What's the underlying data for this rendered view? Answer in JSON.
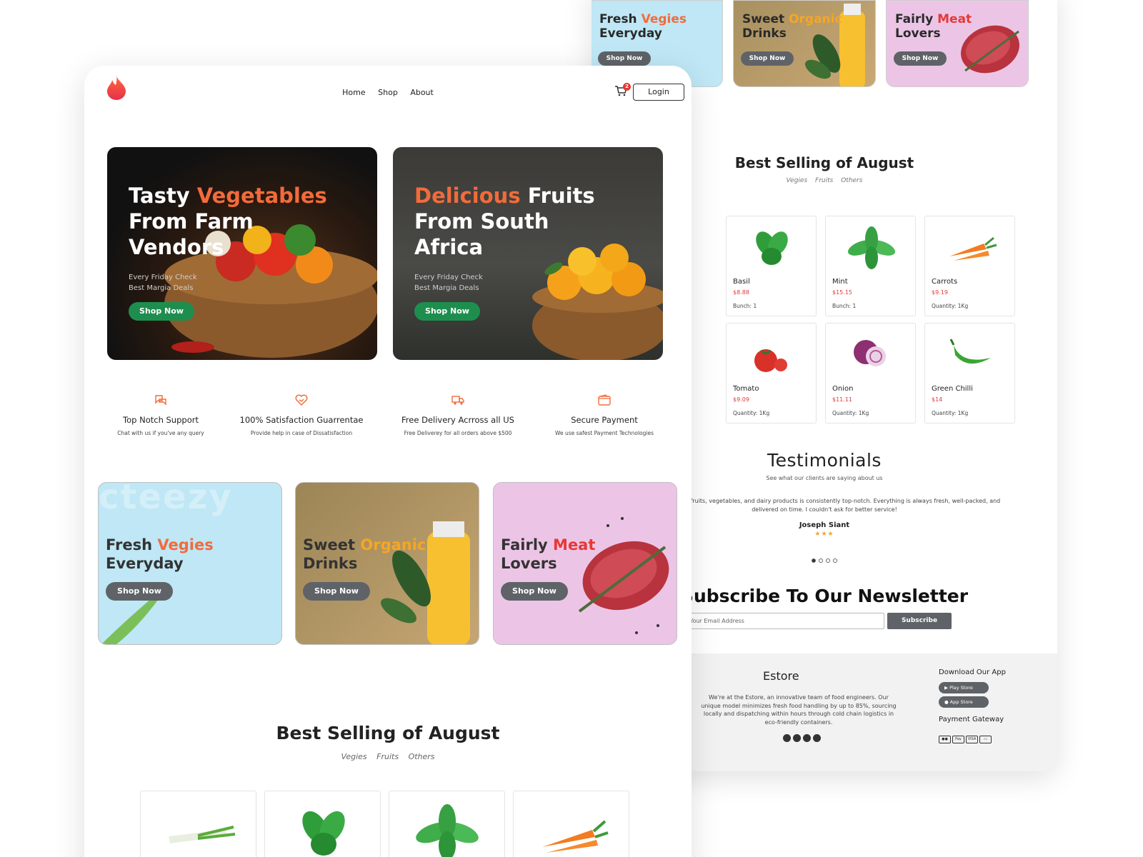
{
  "colors": {
    "accent_orange": "#f26b3a",
    "accent_red": "#e53935",
    "accent_yellow": "#f5a623",
    "green_button": "#1e8e4e",
    "grey_button": "#5f6368"
  },
  "nav": {
    "items": [
      "Home",
      "Shop",
      "About"
    ],
    "cart_count": "2",
    "login": "Login"
  },
  "hero": [
    {
      "line1_a": "Tasty ",
      "line1_b": "Vegetables",
      "line2": "From Farm",
      "line3": "Vendors",
      "sub1": "Every Friday Check",
      "sub2": "Best Margia Deals",
      "button": "Shop Now"
    },
    {
      "line1_a": "Delicious",
      "line1_b": " Fruits",
      "line2": "From South",
      "line3": "Africa",
      "sub1": "Every Friday Check",
      "sub2": "Best Margia Deals",
      "button": "Shop Now"
    }
  ],
  "features": [
    {
      "icon": "chat-icon",
      "title": "Top Notch Support",
      "desc": "Chat with us if you've any query"
    },
    {
      "icon": "heart-handshake-icon",
      "title": "100% Satisfaction Guarrentae",
      "desc": "Provide help in case of Dissatisfaction"
    },
    {
      "icon": "truck-icon",
      "title": "Free Delivery Acrross all US",
      "desc": "Free Deliverey for all orders above $500"
    },
    {
      "icon": "wallet-icon",
      "title": "Secure Payment",
      "desc": "We use safest Payment Technologies"
    }
  ],
  "promos": [
    {
      "a": "Fresh ",
      "b": "Vegies",
      "line2": "Everyday",
      "button": "Shop Now"
    },
    {
      "a": "Sweet ",
      "b": "Organic",
      "line2": "Drinks",
      "button": "Shop Now"
    },
    {
      "a": "Fairly ",
      "b": "Meat",
      "line2": "Lovers",
      "button": "Shop Now"
    }
  ],
  "best_selling": {
    "title": "Best Selling of August",
    "tabs": [
      "Vegies",
      "Fruits",
      "Others"
    ]
  },
  "products": [
    {
      "name": "Basil",
      "price": "$8.88",
      "qty": "Bunch: 1",
      "icon": "basil-icon"
    },
    {
      "name": "Mint",
      "price": "$15.15",
      "qty": "Bunch: 1",
      "icon": "mint-icon"
    },
    {
      "name": "Carrots",
      "price": "$9.19",
      "qty": "Quantity: 1Kg",
      "icon": "carrot-icon"
    },
    {
      "name": "Tomato",
      "price": "$9.09",
      "qty": "Quantity: 1Kg",
      "icon": "tomato-icon"
    },
    {
      "name": "Onion",
      "price": "$11.11",
      "qty": "Quantity: 1Kg",
      "icon": "onion-icon"
    },
    {
      "name": "Green Chilli",
      "price": "$14",
      "qty": "Quantity: 1Kg",
      "icon": "chilli-icon"
    }
  ],
  "testimonials": {
    "title": "Testimonials",
    "subtitle": "See what our clients are saying about us",
    "quote": "of Fresh Bite's fruits, vegetables, and dairy products is consistently top-notch. Everything is always fresh, well-packed, and delivered on time. I couldn't ask for better service!",
    "name": "Joseph Siant",
    "stars": "★★★"
  },
  "newsletter": {
    "title": "Subscribe To Our Newsletter",
    "placeholder": "er Your Email Address",
    "button": "Subscribe"
  },
  "footer": {
    "brand": "Estore",
    "desc": "We're at the Estore, an innovative team of food engineers. Our unique model minimizes fresh food handling by up to 85%, sourcing locally and dispatching within hours through cold chain logistics in eco-friendly containers.",
    "download": "Download Our App",
    "play_store": "Play Store",
    "app_store": "App Store",
    "payment": "Payment Gateway",
    "pay_methods": [
      "Pay",
      "VISA"
    ]
  }
}
